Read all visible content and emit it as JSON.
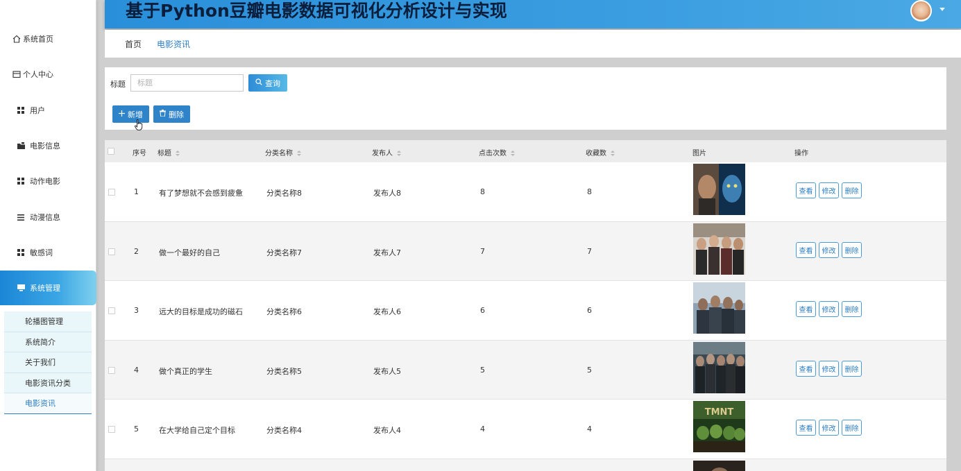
{
  "app": {
    "title": "基于Python豆瓣电影数据可视化分析设计与实现"
  },
  "sidebar": {
    "items": [
      {
        "label": "系统首页",
        "icon": "home-icon"
      },
      {
        "label": "个人中心",
        "icon": "wallet-icon"
      },
      {
        "label": "用户",
        "icon": "grid-icon"
      },
      {
        "label": "电影信息",
        "icon": "folder-icon"
      },
      {
        "label": "动作电影",
        "icon": "grid-icon"
      },
      {
        "label": "动漫信息",
        "icon": "list-icon"
      },
      {
        "label": "敏感词",
        "icon": "grid-icon"
      },
      {
        "label": "系统管理",
        "icon": "monitor-icon",
        "active": true
      }
    ],
    "sub_items": [
      {
        "label": "轮播图管理"
      },
      {
        "label": "系统简介"
      },
      {
        "label": "关于我们"
      },
      {
        "label": "电影资讯分类"
      },
      {
        "label": "电影资讯",
        "selected": true
      }
    ]
  },
  "breadcrumb": {
    "home": "首页",
    "current": "电影资讯"
  },
  "search": {
    "label": "标题",
    "placeholder": "标题",
    "value": "",
    "query_button": "查询"
  },
  "toolbar": {
    "add_label": "新增",
    "delete_label": "删除"
  },
  "table": {
    "headers": {
      "index": "序号",
      "title": "标题",
      "category": "分类名称",
      "publisher": "发布人",
      "clicks": "点击次数",
      "favorites": "收藏数",
      "image": "图片",
      "actions": "操作"
    },
    "rows": [
      {
        "index": "1",
        "title": "有了梦想就不会感到疲惫",
        "category": "分类名称8",
        "publisher": "发布人8",
        "clicks": "8",
        "favorites": "8"
      },
      {
        "index": "2",
        "title": "做一个最好的自己",
        "category": "分类名称7",
        "publisher": "发布人7",
        "clicks": "7",
        "favorites": "7"
      },
      {
        "index": "3",
        "title": "远大的目标是成功的磁石",
        "category": "分类名称6",
        "publisher": "发布人6",
        "clicks": "6",
        "favorites": "6"
      },
      {
        "index": "4",
        "title": "做个真正的学生",
        "category": "分类名称5",
        "publisher": "发布人5",
        "clicks": "5",
        "favorites": "5"
      },
      {
        "index": "5",
        "title": "在大学给自己定个目标",
        "category": "分类名称4",
        "publisher": "发布人4",
        "clicks": "4",
        "favorites": "4"
      }
    ],
    "row_actions": {
      "view": "查看",
      "edit": "修改",
      "delete": "删除"
    },
    "thumbnail_poster_text": "TMNT"
  },
  "colors": {
    "accent": "#2c7dc2",
    "header": "#2a8fda",
    "title": "#0b1e3c"
  }
}
